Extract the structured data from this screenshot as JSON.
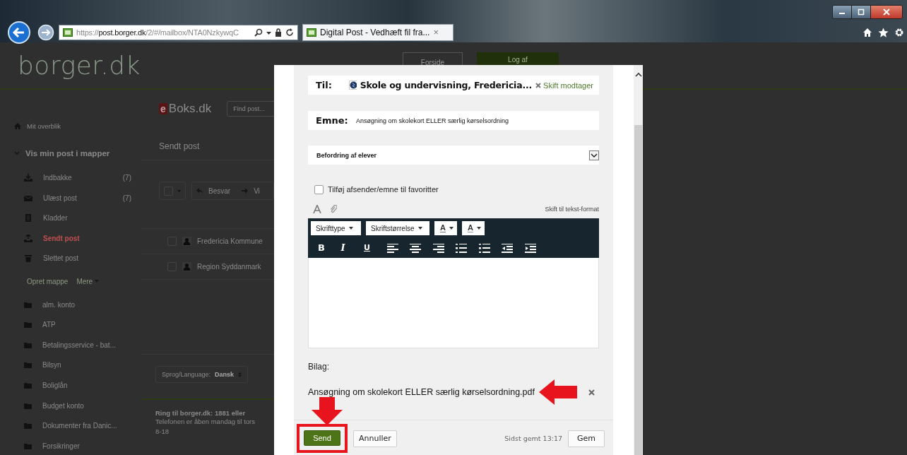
{
  "browser": {
    "address_scheme": "https://",
    "address_host": "post.borger.dk",
    "address_path": "/2/#/mailbox/NTA0NzkywqC",
    "tab_title": "Digital Post - Vedhæft fil fra...",
    "tab_close": "×"
  },
  "site": {
    "logo": "borger.dk",
    "header_buttons": [
      "Forside",
      "Log af"
    ]
  },
  "sidebar": {
    "overview": "Mit overblik",
    "section": {
      "label": "Vis min post i mapper",
      "expanded": true
    },
    "items": [
      {
        "kind": "inbox",
        "label": "Indbakke",
        "count": "(7)",
        "selected": false
      },
      {
        "kind": "unread",
        "label": "Ulæst post",
        "count": "(7)",
        "selected": false
      },
      {
        "kind": "drafts",
        "label": "Kladder",
        "selected": false
      },
      {
        "kind": "sent",
        "label": "Sendt post",
        "selected": true
      },
      {
        "kind": "deleted",
        "label": "Slettet post",
        "selected": false
      }
    ],
    "actions": [
      "Opret mappe",
      "Mere"
    ],
    "folders": [
      "alm. konto",
      "ATP",
      "Betalingsservice - bat...",
      "Bilsyn",
      "Boliglån",
      "Budget konto",
      "Dokumenter fra Danic...",
      "Forsikringer"
    ]
  },
  "main": {
    "brand_mark": "e",
    "brand_text": "Boks.dk",
    "search": {
      "placeholder": "Find post..."
    },
    "heading": "Sendt post",
    "toolbar": [
      "Besvar",
      "Vi"
    ],
    "rows": [
      {
        "sender": "Fredericia Kommune",
        "checked": false
      },
      {
        "sender": "Region Syddanmark",
        "checked": false
      }
    ],
    "language": {
      "label": "Sprog/Language:",
      "value": "Dansk"
    },
    "footer": {
      "phone": "Ring til borger.dk: 1881 eller",
      "hours": "Telefonen er åben mandag til tors",
      "hours_2": "8-18"
    }
  },
  "modal": {
    "to": {
      "label": "Til:",
      "value": "Skole og undervisning, Fredericia...",
      "action": "Skift modtager"
    },
    "subject": {
      "label": "Emne:",
      "value": "Ansøgning om skolekort ELLER særlig kørselsordning"
    },
    "category": "Befordring af elever",
    "favorite": {
      "label": "Tilføj afsender/emne til favoritter",
      "checked": false
    },
    "editor": {
      "switch_format": "Skift til tekst-format",
      "dropdowns": [
        "Skrifttype",
        "Skriftstørrelse"
      ],
      "color_buttons": [
        "A",
        "A"
      ],
      "tools": [
        {
          "kind": "bold",
          "label": "B"
        },
        {
          "kind": "italic",
          "label": "I"
        },
        {
          "kind": "underline",
          "label": "U"
        },
        {
          "kind": "align-left"
        },
        {
          "kind": "align-center"
        },
        {
          "kind": "align-right"
        },
        {
          "kind": "bullets"
        },
        {
          "kind": "numbers"
        },
        {
          "kind": "outdent"
        },
        {
          "kind": "indent"
        }
      ]
    },
    "attachments": {
      "label": "Bilag:",
      "files": [
        {
          "name": "Ansøgning om skolekort ELLER særlig kørselsordning.pdf"
        }
      ]
    },
    "footer": {
      "send": "Send",
      "cancel": "Annuller",
      "saved": "Sidst gemt 13:17",
      "save": "Gem"
    }
  }
}
